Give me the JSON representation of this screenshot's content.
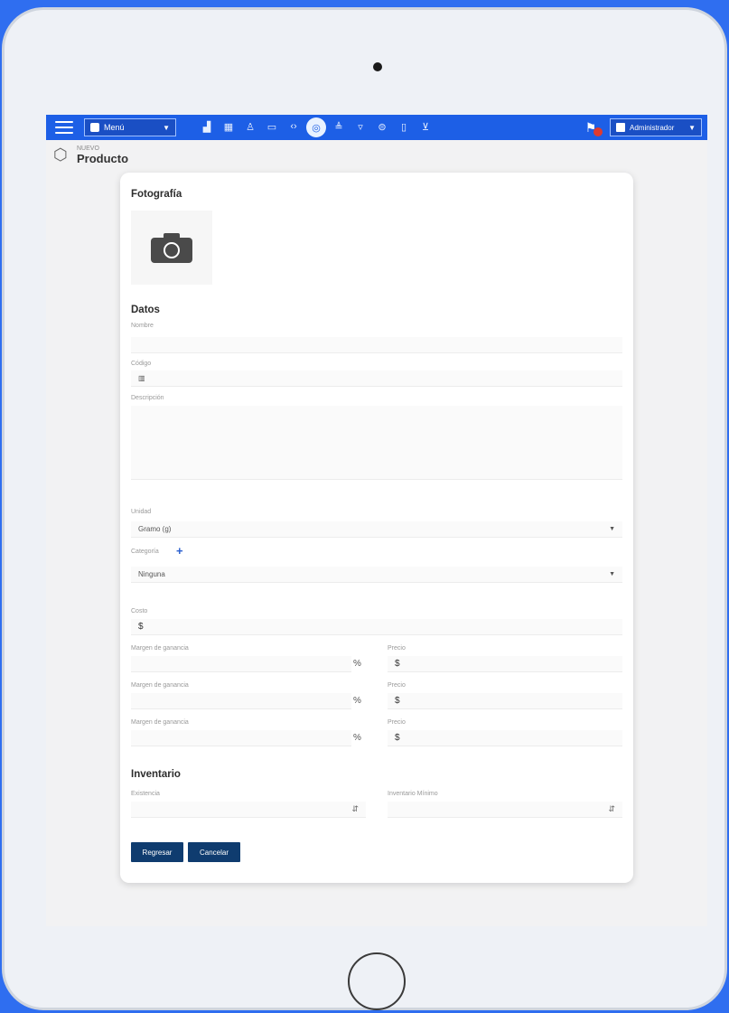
{
  "topbar": {
    "menu_label": "Menú",
    "admin_label": "Administrador",
    "icons": [
      "chart-icon",
      "grid-icon",
      "user-icon",
      "tag-icon",
      "code-icon",
      "globe-icon",
      "layers-icon",
      "funnel-icon",
      "printer-icon",
      "clipboard-icon",
      "cart-icon"
    ]
  },
  "page": {
    "breadcrumb": "NUEVO",
    "title": "Producto"
  },
  "photo": {
    "title": "Fotografía"
  },
  "datos": {
    "title": "Datos",
    "nombre_label": "Nombre",
    "codigo_label": "Código",
    "descripcion_label": "Descripción",
    "unidad_label": "Unidad",
    "unidad_value": "Gramo (g)",
    "categoria_label": "Categoría",
    "categoria_value": "Ninguna",
    "costo_label": "Costo",
    "currency_symbol": "$",
    "percent_symbol": "%",
    "margin_label": "Margen de ganancia",
    "price_label": "Precio"
  },
  "inventario": {
    "title": "Inventario",
    "existencia_label": "Existencia",
    "minimo_label": "Inventario Mínimo"
  },
  "buttons": {
    "back": "Regresar",
    "cancel": "Cancelar"
  }
}
